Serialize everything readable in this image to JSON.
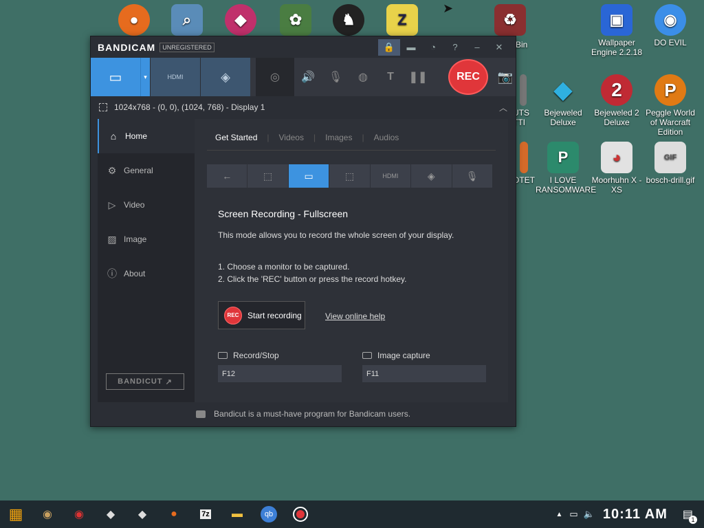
{
  "desktop_icons": [
    {
      "name": "firefox-desktop-icon",
      "label": "",
      "icon": "firefox-icon",
      "color": "#e66b1e",
      "glyph": "●"
    },
    {
      "name": "search-desktop-icon",
      "label": "",
      "icon": "magnifier-icon",
      "color": "#5a8cb8",
      "glyph": "⌕"
    },
    {
      "name": "gem-desktop-icon",
      "label": "",
      "icon": "gem-icon",
      "color": "#c0306b",
      "glyph": "◆"
    },
    {
      "name": "flower-desktop-icon",
      "label": "",
      "icon": "flower-icon",
      "color": "#4a7d42",
      "glyph": "✿"
    },
    {
      "name": "lion-desktop-icon",
      "label": "",
      "icon": "lion-icon",
      "color": "#222",
      "glyph": "♞"
    },
    {
      "name": "zip-desktop-icon",
      "label": "",
      "icon": "zip-folder-icon",
      "color": "#e8d24a",
      "glyph": "Z"
    },
    {
      "name": "recycle-bin-desktop-icon",
      "label": "Bin",
      "icon": "bin-icon",
      "color": "#8a2f30",
      "glyph": "♻"
    },
    {
      "name": "wallpaper-engine-desktop-icon",
      "label": "Wallpaper Engine 2.2.18",
      "icon": "wallpaper-engine-icon",
      "color": "#2a66d6",
      "glyph": "▣"
    },
    {
      "name": "do-evil-desktop-icon",
      "label": "DO EVIL",
      "icon": "chrome-icon",
      "color": "#3b8ee8",
      "glyph": "◉"
    },
    {
      "name": "outs-desktop-icon",
      "label": "UTS TTI",
      "icon": "doc-icon",
      "color": "#777",
      "glyph": "▤"
    },
    {
      "name": "bejeweled-desktop-icon",
      "label": "Bejeweled Deluxe",
      "icon": "diamond-icon",
      "color": "#2fb0e0",
      "glyph": "◆"
    },
    {
      "name": "bejeweled2-desktop-icon",
      "label": "Bejeweled 2 Deluxe",
      "icon": "bejeweled2-icon",
      "color": "#c02a34",
      "glyph": "2"
    },
    {
      "name": "peggle-desktop-icon",
      "label": "Peggle World of Warcraft Edition",
      "icon": "peggle-icon",
      "color": "#e07a14",
      "glyph": "P"
    },
    {
      "name": "otet-desktop-icon",
      "label": "OTET",
      "icon": "doc-icon",
      "color": "#d66b2a",
      "glyph": "▤"
    },
    {
      "name": "ransomware-desktop-icon",
      "label": "I LOVE RANSOMWARE",
      "icon": "publisher-icon",
      "color": "#2c8a6c",
      "glyph": "P"
    },
    {
      "name": "moorhuhn-desktop-icon",
      "label": "Moorhuhn X - XS",
      "icon": "chicken-icon",
      "color": "#e2e2e2",
      "glyph": "🐔"
    },
    {
      "name": "gif-desktop-icon",
      "label": "bosch-drill.gif",
      "icon": "gif-file-icon",
      "color": "#ddd",
      "glyph": "GIF"
    }
  ],
  "window": {
    "brand": "BANDICAM",
    "unregistered": "UNREGISTERED",
    "titlebar_icons": [
      "lock-icon",
      "folder-icon",
      "clock-icon",
      "help-icon",
      "minimize-icon",
      "close-icon"
    ],
    "toolbar": {
      "rec_label": "REC"
    },
    "area_text": "1024x768 - (0, 0), (1024, 768) - Display 1",
    "sidebar": [
      {
        "label": "Home",
        "icon": "home-icon",
        "active": true
      },
      {
        "label": "General",
        "icon": "gear-icon",
        "active": false
      },
      {
        "label": "Video",
        "icon": "video-icon",
        "active": false
      },
      {
        "label": "Image",
        "icon": "image-icon",
        "active": false
      },
      {
        "label": "About",
        "icon": "info-icon",
        "active": false
      }
    ],
    "bandicut_label": "BANDICUT",
    "tabs": [
      "Get Started",
      "Videos",
      "Images",
      "Audios"
    ],
    "heading": "Screen Recording - Fullscreen",
    "description": "This mode allows you to record the whole screen of your display.",
    "steps": [
      "1. Choose a monitor to be captured.",
      "2. Click the 'REC' button or press the record hotkey."
    ],
    "start_button": "Start recording",
    "start_rec_badge": "REC",
    "help_link": "View online help",
    "hotkeys": [
      {
        "label": "Record/Stop",
        "value": "F12"
      },
      {
        "label": "Image capture",
        "value": "F11"
      }
    ],
    "footer_text": "Bandicut is a must-have program for Bandicam users."
  },
  "taskbar": {
    "clock": "10:11 AM",
    "notification_count": "1"
  }
}
